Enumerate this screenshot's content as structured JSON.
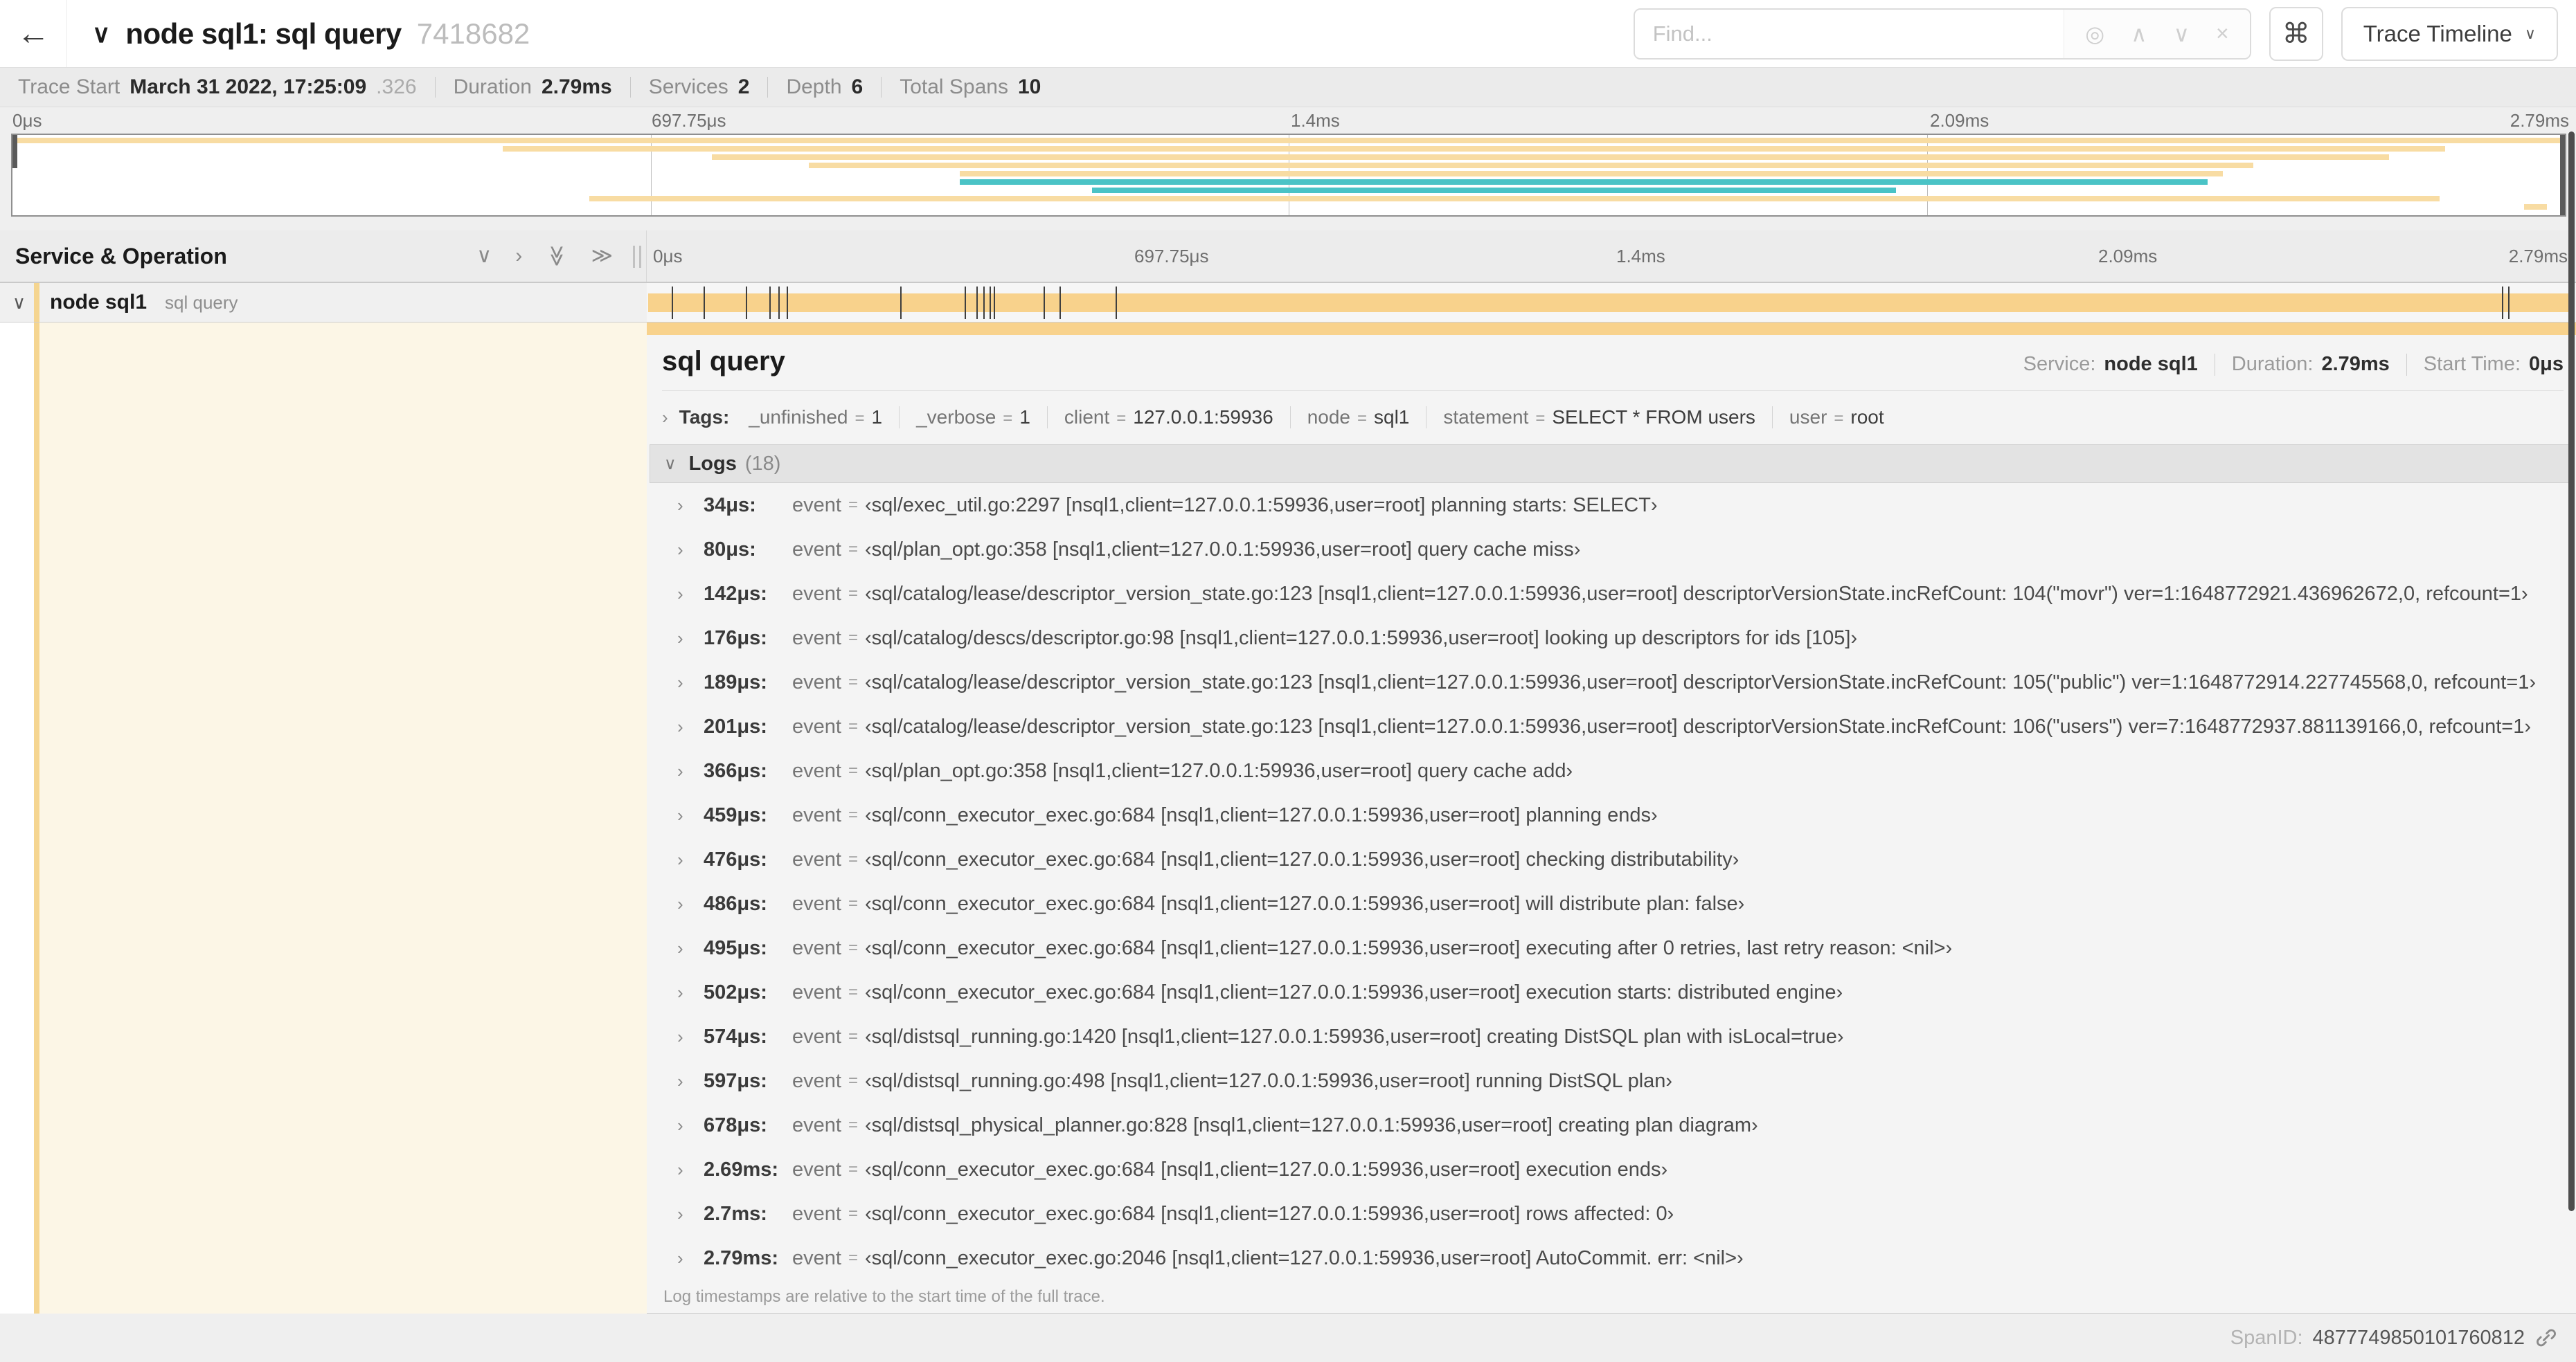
{
  "header": {
    "title": "node sql1: sql query",
    "trace_id": "7418682",
    "find_placeholder": "Find...",
    "view_selector": "Trace Timeline"
  },
  "icons": {
    "back": "←",
    "title_chevron": "∨",
    "shortcut": "⌘",
    "dropdown_caret": "∨",
    "expanded_chevron": "∨",
    "collapsed_chevron": "›"
  },
  "find_controls": [
    {
      "name": "find-locate-icon",
      "glyph": "◎"
    },
    {
      "name": "find-prev-icon",
      "glyph": "∧"
    },
    {
      "name": "find-next-icon",
      "glyph": "∨"
    },
    {
      "name": "find-clear-icon",
      "glyph": "×"
    }
  ],
  "trace_stats": [
    {
      "label": "Trace Start",
      "value": "March 31 2022, 17:25:09",
      "suffix": ".326"
    },
    {
      "label": "Duration",
      "value": "2.79ms"
    },
    {
      "label": "Services",
      "value": "2"
    },
    {
      "label": "Depth",
      "value": "6"
    },
    {
      "label": "Total Spans",
      "value": "10"
    }
  ],
  "minimap": {
    "ticks": [
      "0μs",
      "697.75μs",
      "1.4ms",
      "2.09ms",
      "2.79ms"
    ],
    "span_colors": {
      "y": "#f8dca3",
      "t": "#4ac3c6"
    },
    "spans": [
      {
        "left": 0,
        "width": 100,
        "color": "y"
      },
      {
        "left": 19.2,
        "width": 76.1,
        "color": "y"
      },
      {
        "left": 27.4,
        "width": 65.7,
        "color": "y"
      },
      {
        "left": 31.2,
        "width": 56.6,
        "color": "y"
      },
      {
        "left": 37.1,
        "width": 49.5,
        "color": "y"
      },
      {
        "left": 37.1,
        "width": 48.9,
        "color": "t"
      },
      {
        "left": 42.3,
        "width": 31.5,
        "color": "t"
      },
      {
        "left": 22.6,
        "width": 72.5,
        "color": "y"
      },
      {
        "left": 98.4,
        "width": 0.9,
        "color": "y"
      }
    ]
  },
  "columns": {
    "left_title": "Service & Operation",
    "header_icons": [
      {
        "name": "collapse-one-icon",
        "glyph": "∨",
        "rotate": false
      },
      {
        "name": "expand-one-icon",
        "glyph": "›",
        "rotate": false
      },
      {
        "name": "collapse-all-icon",
        "glyph": "≫",
        "rotate": true
      },
      {
        "name": "expand-all-icon",
        "glyph": "≫",
        "rotate": false
      }
    ],
    "ticks": [
      "0μs",
      "697.75μs",
      "1.4ms",
      "2.09ms",
      "2.79ms"
    ]
  },
  "span_row": {
    "service": "node sql1",
    "operation": "sql query",
    "total_us": 2790,
    "log_ticks_us": [
      34,
      80,
      142,
      176,
      189,
      201,
      366,
      459,
      476,
      486,
      495,
      502,
      574,
      597,
      678,
      2690,
      2700,
      2790
    ]
  },
  "detail": {
    "title": "sql query",
    "meta": {
      "service_label": "Service:",
      "service_value": "node sql1",
      "duration_label": "Duration:",
      "duration_value": "2.79ms",
      "start_label": "Start Time:",
      "start_value": "0μs"
    },
    "tags": {
      "label": "Tags:",
      "eq": "=",
      "items": [
        {
          "key": "_unfinished",
          "value": "1"
        },
        {
          "key": "_verbose",
          "value": "1"
        },
        {
          "key": "client",
          "value": "127.0.0.1:59936"
        },
        {
          "key": "node",
          "value": "sql1"
        },
        {
          "key": "statement",
          "value": "SELECT * FROM users"
        },
        {
          "key": "user",
          "value": "root"
        }
      ]
    },
    "logs": {
      "label": "Logs",
      "count": "(18)",
      "key_label": "event",
      "eq": "=",
      "entries": [
        {
          "time": "34μs:",
          "value": "‹sql/exec_util.go:2297 [nsql1,client=127.0.0.1:59936,user=root] planning starts: SELECT›"
        },
        {
          "time": "80μs:",
          "value": "‹sql/plan_opt.go:358 [nsql1,client=127.0.0.1:59936,user=root] query cache miss›"
        },
        {
          "time": "142μs:",
          "value": "‹sql/catalog/lease/descriptor_version_state.go:123 [nsql1,client=127.0.0.1:59936,user=root] descriptorVersionState.incRefCount: 104(\"movr\") ver=1:1648772921.436962672,0, refcount=1›"
        },
        {
          "time": "176μs:",
          "value": "‹sql/catalog/descs/descriptor.go:98 [nsql1,client=127.0.0.1:59936,user=root] looking up descriptors for ids [105]›"
        },
        {
          "time": "189μs:",
          "value": "‹sql/catalog/lease/descriptor_version_state.go:123 [nsql1,client=127.0.0.1:59936,user=root] descriptorVersionState.incRefCount: 105(\"public\") ver=1:1648772914.227745568,0, refcount=1›"
        },
        {
          "time": "201μs:",
          "value": "‹sql/catalog/lease/descriptor_version_state.go:123 [nsql1,client=127.0.0.1:59936,user=root] descriptorVersionState.incRefCount: 106(\"users\") ver=7:1648772937.881139166,0, refcount=1›"
        },
        {
          "time": "366μs:",
          "value": "‹sql/plan_opt.go:358 [nsql1,client=127.0.0.1:59936,user=root] query cache add›"
        },
        {
          "time": "459μs:",
          "value": "‹sql/conn_executor_exec.go:684 [nsql1,client=127.0.0.1:59936,user=root] planning ends›"
        },
        {
          "time": "476μs:",
          "value": "‹sql/conn_executor_exec.go:684 [nsql1,client=127.0.0.1:59936,user=root] checking distributability›"
        },
        {
          "time": "486μs:",
          "value": "‹sql/conn_executor_exec.go:684 [nsql1,client=127.0.0.1:59936,user=root] will distribute plan: false›"
        },
        {
          "time": "495μs:",
          "value": "‹sql/conn_executor_exec.go:684 [nsql1,client=127.0.0.1:59936,user=root] executing after 0 retries, last retry reason: <nil>›"
        },
        {
          "time": "502μs:",
          "value": "‹sql/conn_executor_exec.go:684 [nsql1,client=127.0.0.1:59936,user=root] execution starts: distributed engine›"
        },
        {
          "time": "574μs:",
          "value": "‹sql/distsql_running.go:1420 [nsql1,client=127.0.0.1:59936,user=root] creating DistSQL plan with isLocal=true›"
        },
        {
          "time": "597μs:",
          "value": "‹sql/distsql_running.go:498 [nsql1,client=127.0.0.1:59936,user=root] running DistSQL plan›"
        },
        {
          "time": "678μs:",
          "value": "‹sql/distsql_physical_planner.go:828 [nsql1,client=127.0.0.1:59936,user=root] creating plan diagram›"
        },
        {
          "time": "2.69ms:",
          "value": "‹sql/conn_executor_exec.go:684 [nsql1,client=127.0.0.1:59936,user=root] execution ends›"
        },
        {
          "time": "2.7ms:",
          "value": "‹sql/conn_executor_exec.go:684 [nsql1,client=127.0.0.1:59936,user=root] rows affected: 0›"
        },
        {
          "time": "2.79ms:",
          "value": "‹sql/conn_executor_exec.go:2046 [nsql1,client=127.0.0.1:59936,user=root] AutoCommit. err: <nil>›"
        }
      ],
      "footnote": "Log timestamps are relative to the start time of the full trace."
    },
    "span_id_label": "SpanID:",
    "span_id": "4877749850101760812"
  }
}
